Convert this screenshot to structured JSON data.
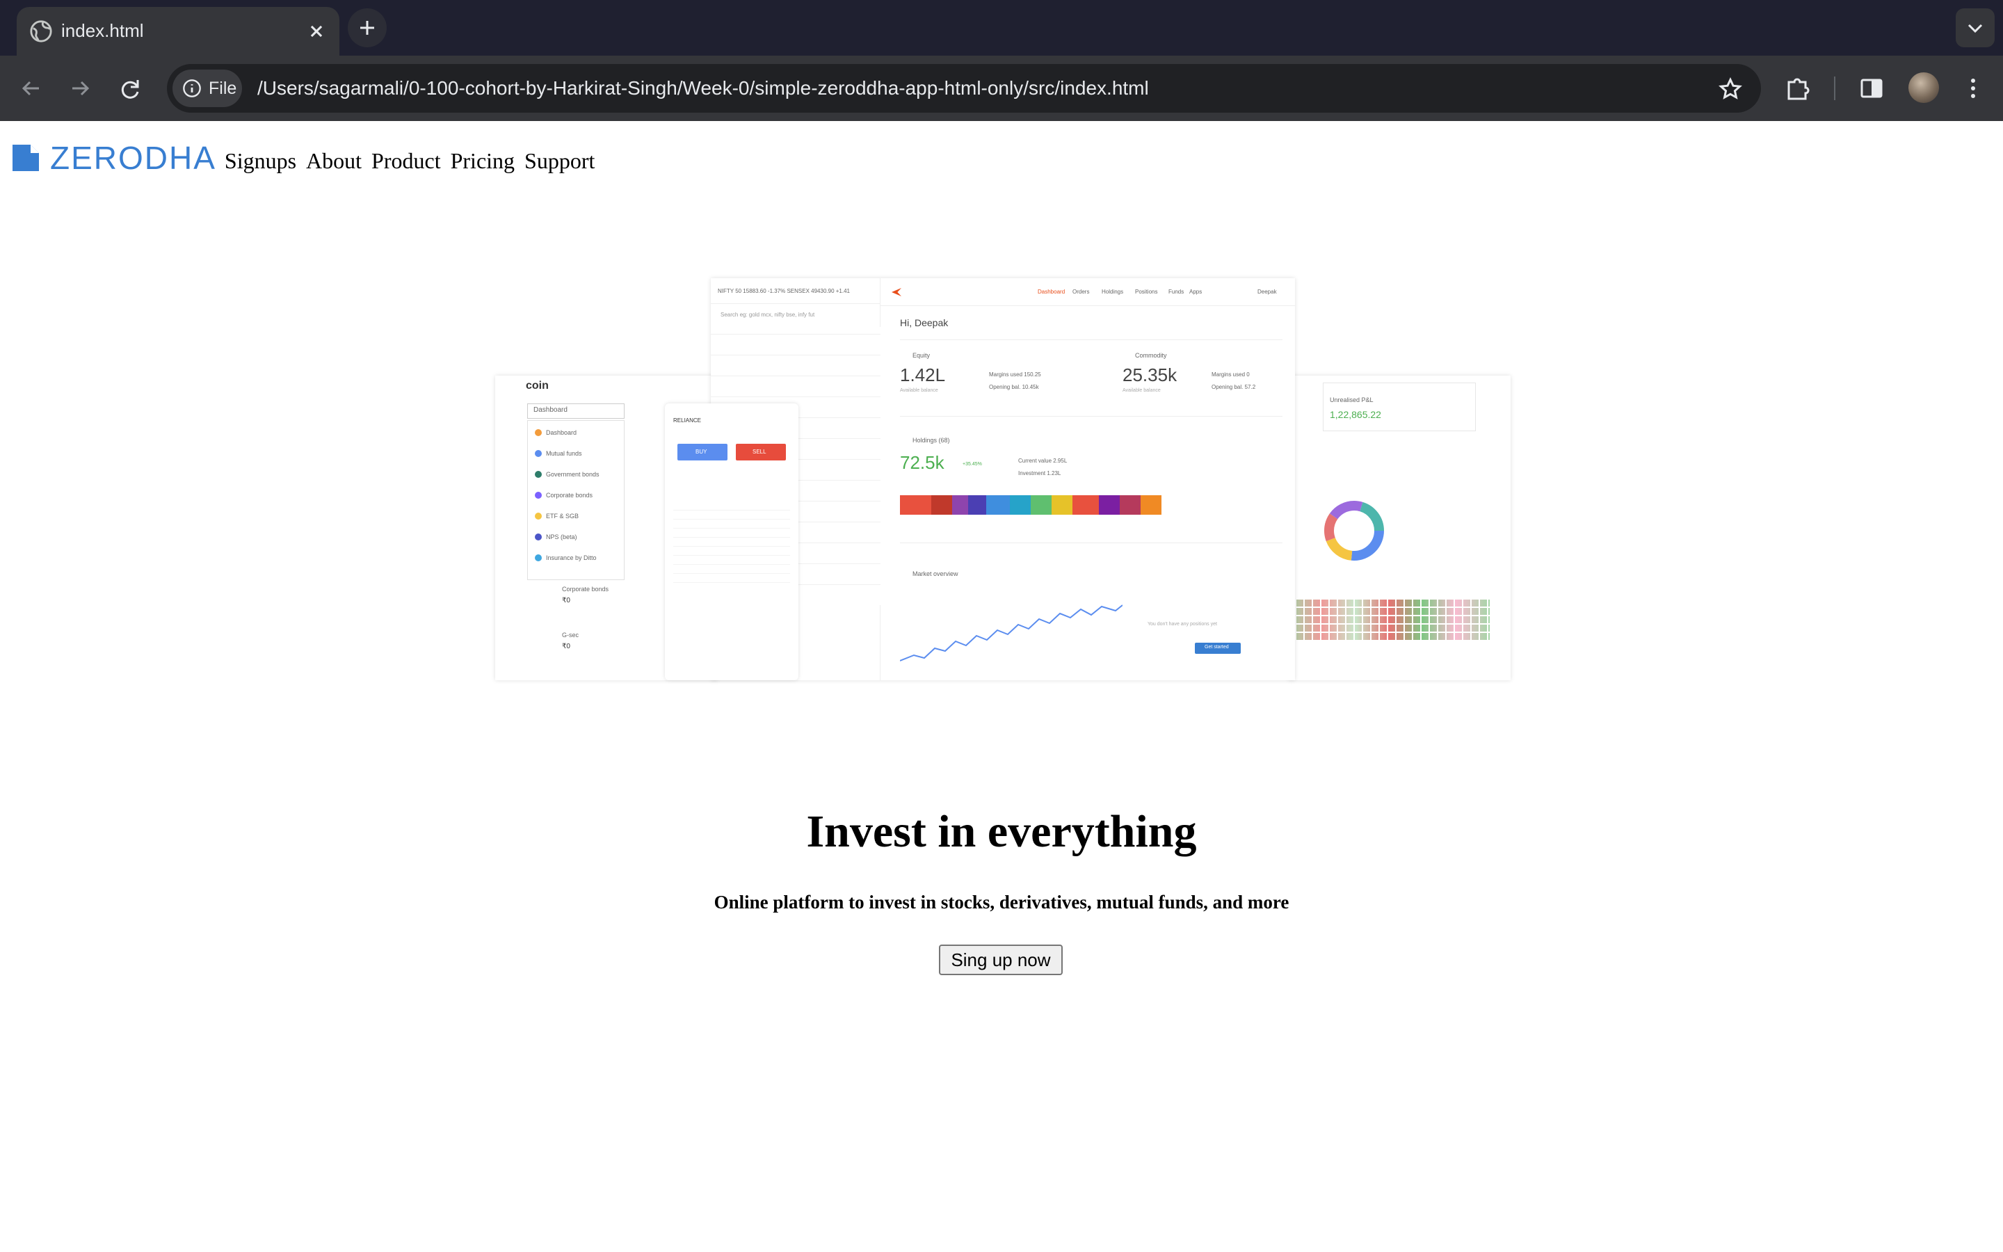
{
  "browser": {
    "tab_title": "index.html",
    "scheme_chip": "File",
    "url": "/Users/sagarmali/0-100-cohort-by-Harkirat-Singh/Week-0/simple-zeroddha-app-html-only/src/index.html"
  },
  "brand": {
    "logo_text": "ZERODHA",
    "color": "#387ed1"
  },
  "nav": {
    "items": [
      "Signups",
      "About",
      "Product",
      "Pricing",
      "Support"
    ]
  },
  "hero_image": {
    "coin_logo": "coin",
    "coin_menu": [
      "Dashboard",
      "Mutual funds",
      "Government bonds",
      "Corporate bonds",
      "ETF & SGB",
      "NPS (beta)",
      "Insurance by Ditto"
    ],
    "coin_select": "Dashboard",
    "coin_footer": [
      "Corporate bonds",
      "₹0",
      "G-sec",
      "₹0"
    ],
    "watchlist_header": "NIFTY 50  15883.60  -1.37%     SENSEX  49430.90  +1.41",
    "watchlist_search": "Search eg: gold mcx, nifty bse, infy fut",
    "greeting": "Hi, Deepak",
    "equity_label": "Equity",
    "equity_value": "1.42L",
    "equity_sub": "Available balance",
    "equity_margins": [
      "Margins used  150.25",
      "Opening bal.  10.45k"
    ],
    "commodity_label": "Commodity",
    "commodity_value": "25.35k",
    "commodity_sub": "Available balance",
    "commodity_margins": [
      "Margins used  0",
      "Opening bal.  57.2"
    ],
    "holdings_label": "Holdings (68)",
    "holdings_value": "72.5k",
    "holdings_change": "+35.45%",
    "holdings_right": [
      "Current value  2.95L",
      "Investment  1.23L"
    ],
    "market_label": "Market overview",
    "no_positions": "You don't have any positions yet",
    "get_started": "Get started",
    "pnl_label": "Unrealised P&L",
    "pnl_value": "1,22,865.22",
    "buy_label": "BUY",
    "sell_label": "SELL",
    "mobile_title": "RELIANCE",
    "top_nav": [
      "Dashboard",
      "Orders",
      "Holdings",
      "Positions",
      "Funds",
      "Apps",
      "Deepak"
    ]
  },
  "hero": {
    "title": "Invest in everything",
    "subtitle": "Online platform to invest in stocks, derivatives, mutual funds, and more",
    "cta": "Sing up now"
  }
}
